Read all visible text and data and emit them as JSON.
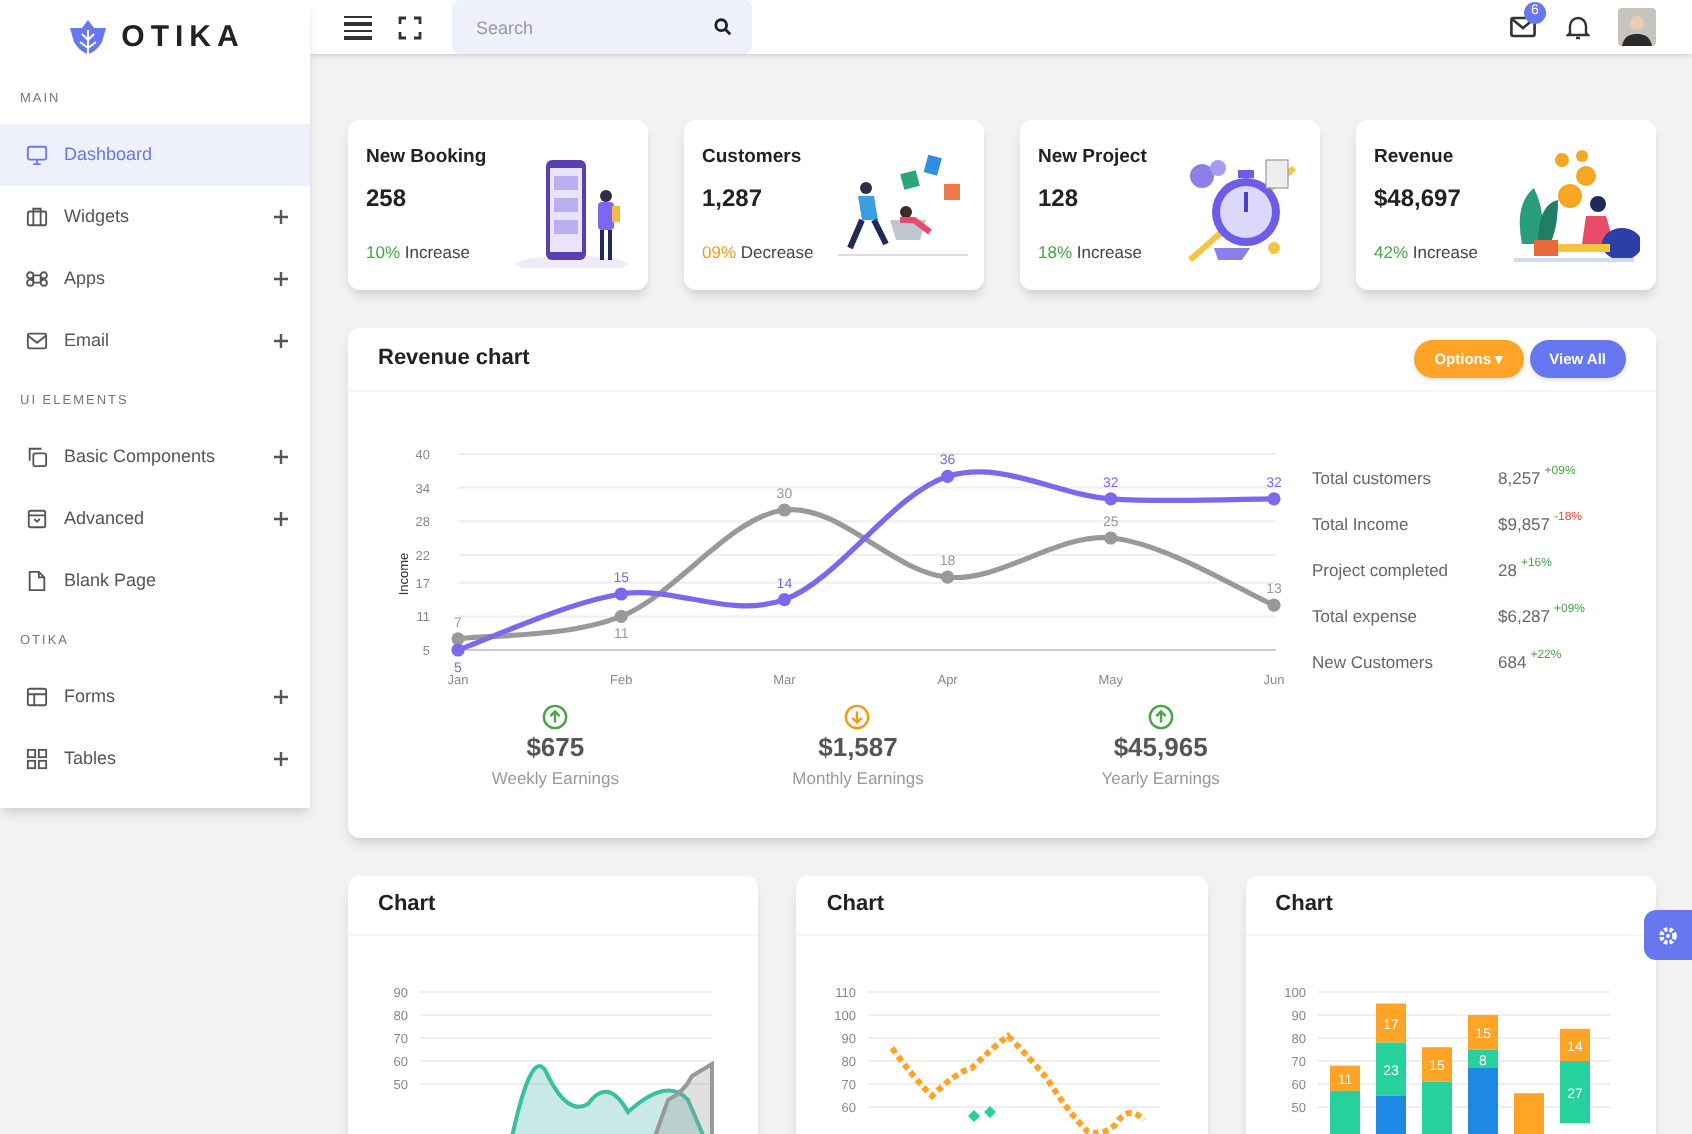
{
  "brand": "OTIKA",
  "sidebar": {
    "sections": [
      {
        "label": "MAIN",
        "items": [
          {
            "label": "Dashboard",
            "selected": true,
            "expandable": false
          },
          {
            "label": "Widgets",
            "selected": false,
            "expandable": true
          },
          {
            "label": "Apps",
            "selected": false,
            "expandable": true
          },
          {
            "label": "Email",
            "selected": false,
            "expandable": true
          }
        ]
      },
      {
        "label": "UI ELEMENTS",
        "items": [
          {
            "label": "Basic Components",
            "selected": false,
            "expandable": true
          },
          {
            "label": "Advanced",
            "selected": false,
            "expandable": true
          },
          {
            "label": "Blank Page",
            "selected": false,
            "expandable": false
          }
        ]
      },
      {
        "label": "OTIKA",
        "items": [
          {
            "label": "Forms",
            "selected": false,
            "expandable": true
          },
          {
            "label": "Tables",
            "selected": false,
            "expandable": true
          }
        ]
      }
    ]
  },
  "header": {
    "search": {
      "placeholder": "Search"
    },
    "mail_badge": "6"
  },
  "stat_cards": [
    {
      "title": "New Booking",
      "value": "258",
      "change": "10%",
      "change_text": "Increase",
      "kind": "increase"
    },
    {
      "title": "Customers",
      "value": "1,287",
      "change": "09%",
      "change_text": "Decrease",
      "kind": "decrease"
    },
    {
      "title": "New Project",
      "value": "128",
      "change": "18%",
      "change_text": "Increase",
      "kind": "increase"
    },
    {
      "title": "Revenue",
      "value": "$48,697",
      "change": "42%",
      "change_text": "Increase",
      "kind": "increase"
    }
  ],
  "revenue": {
    "title": "Revenue chart",
    "buttons": [
      {
        "label": "Options ▾",
        "kind": "dropdown"
      },
      {
        "label": "View All",
        "kind": "primary"
      }
    ],
    "chart_data": {
      "type": "line",
      "ylabel": "Income",
      "categories": [
        "Jan",
        "Feb",
        "Mar",
        "Apr",
        "May",
        "Jun"
      ],
      "series": [
        {
          "color": "#999999",
          "marker": true,
          "values": [
            7,
            11,
            30,
            18,
            25,
            13
          ]
        },
        {
          "color": "#7b68ee",
          "marker": true,
          "values": [
            5,
            15,
            14,
            36,
            32,
            32
          ]
        }
      ],
      "ylim": [
        5,
        40
      ],
      "yticks": [
        5,
        11,
        17,
        22,
        28,
        34,
        40
      ],
      "grid": true,
      "data_labels": true
    },
    "earnings": [
      {
        "amount": "$675",
        "label": "Weekly Earnings",
        "kind": "increase"
      },
      {
        "amount": "$1,587",
        "label": "Monthly Earnings",
        "kind": "decrease"
      },
      {
        "amount": "$45,965",
        "label": "Yearly Earnings",
        "kind": "increase"
      }
    ],
    "summary": [
      {
        "label": "Total customers",
        "value": "8,257",
        "change": "+09%",
        "kind": "increase"
      },
      {
        "label": "Total Income",
        "value": "$9,857",
        "change": "-18%",
        "kind": "decrease"
      },
      {
        "label": "Project completed",
        "value": "28",
        "change": "+16%",
        "kind": "increase"
      },
      {
        "label": "Total expense",
        "value": "$6,287",
        "change": "+09%",
        "kind": "increase"
      },
      {
        "label": "New Customers",
        "value": "684",
        "change": "+22%",
        "kind": "increase"
      }
    ]
  },
  "charts": [
    {
      "title": "Chart",
      "kind": "area",
      "yticks": [
        "90",
        "80",
        "70",
        "60",
        "50"
      ]
    },
    {
      "title": "Chart",
      "kind": "line",
      "yticks": [
        "110",
        "100",
        "90",
        "80",
        "70",
        "60"
      ]
    },
    {
      "title": "Chart",
      "kind": "bar",
      "yticks": [
        "100",
        "90",
        "80",
        "70",
        "60",
        "50"
      ],
      "bars": [
        {
          "segments": [
            {
              "label": "11",
              "color": "#ffa426"
            },
            {
              "color": "#26d19c"
            }
          ]
        },
        {
          "segments": [
            {
              "label": "17",
              "color": "#ffa426"
            },
            {
              "label": "23",
              "color": "#26d19c"
            },
            {
              "color": "#1e88e5"
            }
          ]
        },
        {
          "segments": [
            {
              "label": "15",
              "color": "#ffa426"
            },
            {
              "color": "#26d19c"
            }
          ]
        },
        {
          "segments": [
            {
              "label": "15",
              "color": "#ffa426"
            },
            {
              "label": "8",
              "color": "#26d19c"
            },
            {
              "color": "#1e88e5"
            }
          ]
        },
        {
          "segments": [
            {
              "color": "#ffa426"
            }
          ]
        },
        {
          "segments": [
            {
              "label": "14",
              "color": "#ffa426"
            },
            {
              "label": "27",
              "color": "#26d19c"
            }
          ]
        }
      ]
    }
  ]
}
